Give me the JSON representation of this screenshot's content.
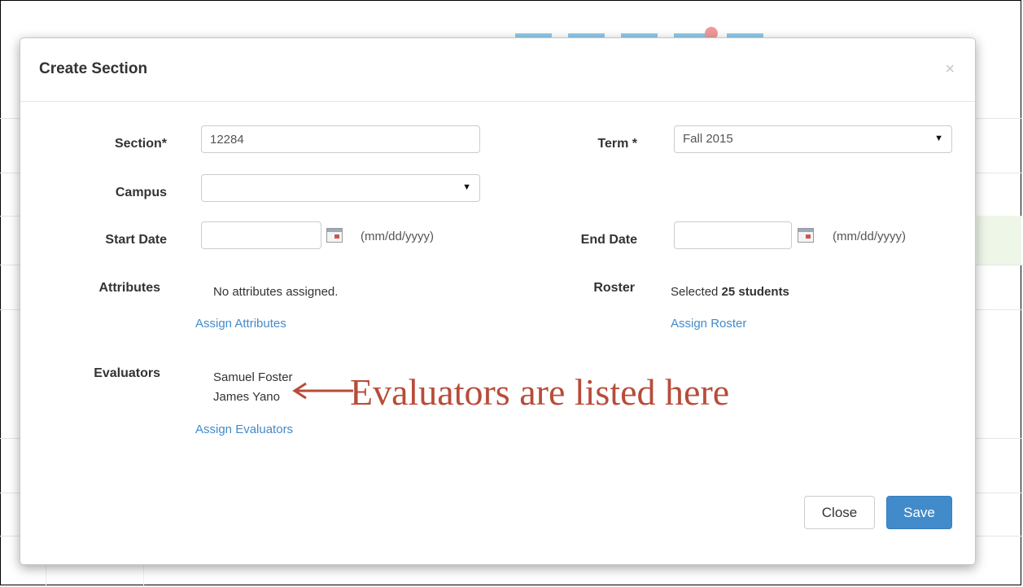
{
  "modal": {
    "title": "Create Section",
    "close_glyph": "×"
  },
  "form": {
    "section_label": "Section*",
    "section_value": "12284",
    "term_label": "Term *",
    "term_value": "Fall 2015",
    "campus_label": "Campus",
    "campus_value": "",
    "start_date_label": "Start Date",
    "start_date_value": "",
    "end_date_label": "End Date",
    "end_date_value": "",
    "date_format_hint": "(mm/dd/yyyy)",
    "attributes_label": "Attributes",
    "attributes_text": "No attributes assigned.",
    "assign_attributes_link": "Assign Attributes",
    "roster_label": "Roster",
    "roster_prefix": "Selected ",
    "roster_count": "25 students",
    "assign_roster_link": "Assign Roster",
    "evaluators_label": "Evaluators",
    "evaluators": [
      "Samuel Foster",
      "James Yano"
    ],
    "assign_evaluators_link": "Assign Evaluators"
  },
  "annotation": {
    "text": "Evaluators are listed here",
    "color": "#b84c3a"
  },
  "footer": {
    "close_label": "Close",
    "save_label": "Save"
  },
  "icons": {
    "select_arrow": "chevron-down-icon",
    "calendar": "calendar-icon"
  },
  "colors": {
    "primary": "#428bca",
    "link": "#428bca"
  }
}
